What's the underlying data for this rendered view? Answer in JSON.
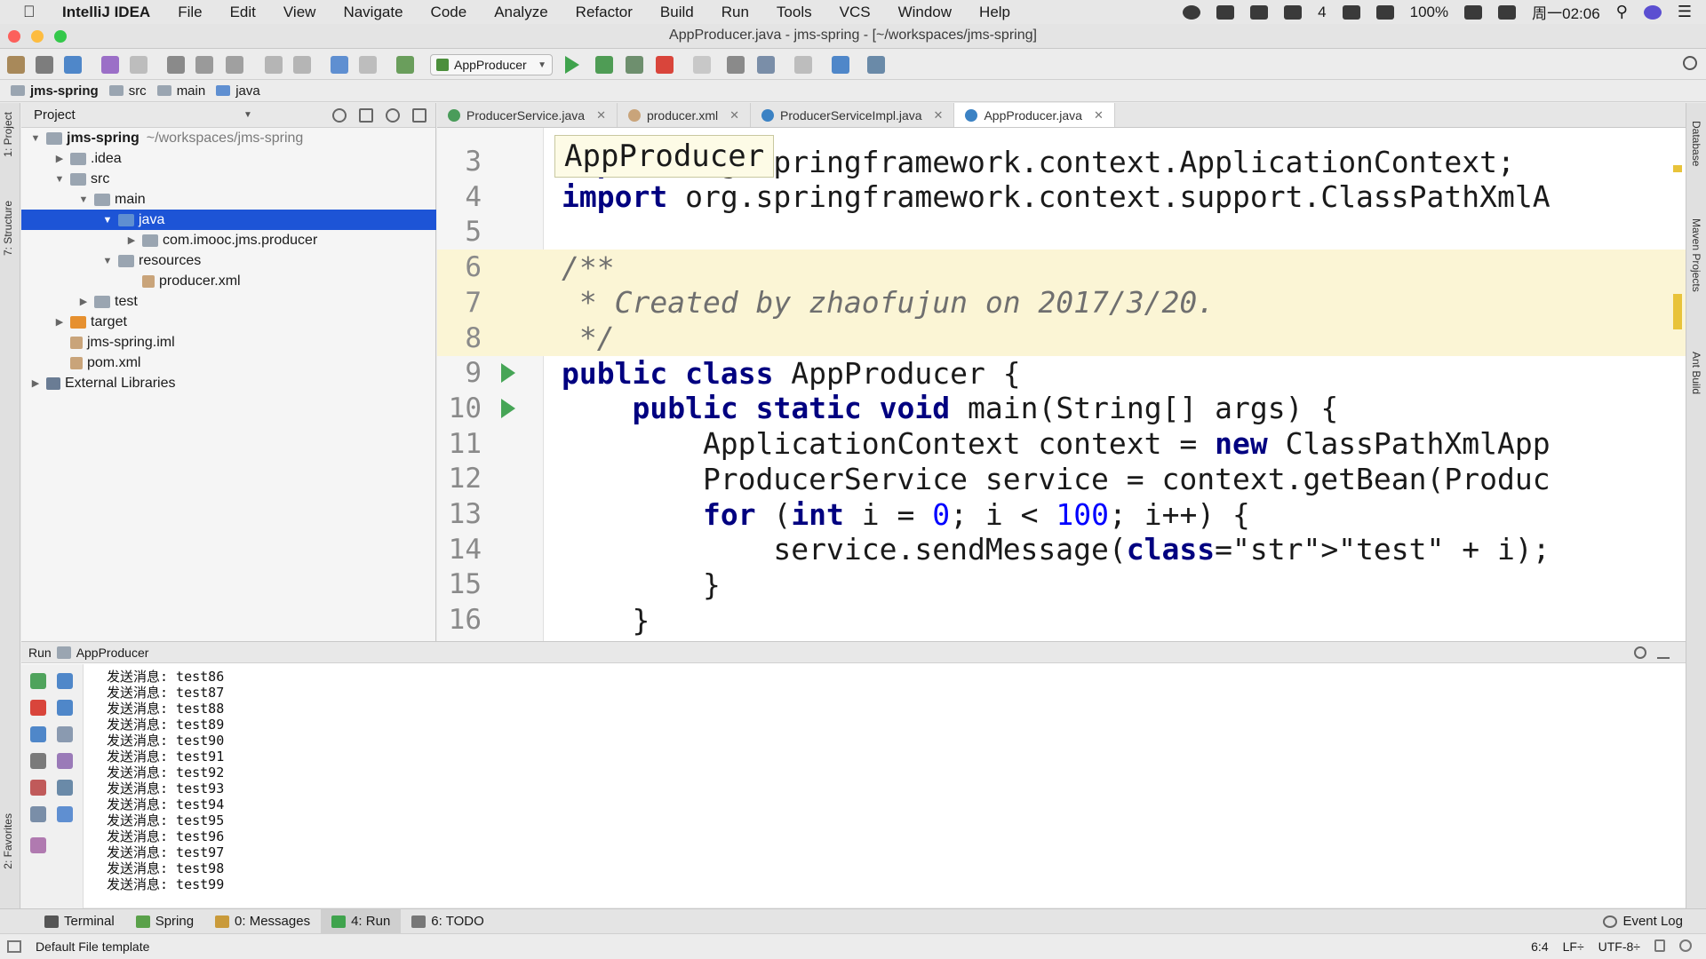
{
  "menubar": {
    "app_name": "IntelliJ IDEA",
    "items": [
      "File",
      "Edit",
      "View",
      "Navigate",
      "Code",
      "Analyze",
      "Refactor",
      "Build",
      "Run",
      "Tools",
      "VCS",
      "Window",
      "Help"
    ],
    "wechat_count": "4",
    "battery": "100%",
    "clock": "周一02:06"
  },
  "window": {
    "title": "AppProducer.java - jms-spring - [~/workspaces/jms-spring]"
  },
  "toolbar": {
    "run_config": "AppProducer"
  },
  "breadcrumb": [
    "jms-spring",
    "src",
    "main",
    "java"
  ],
  "project": {
    "header": "Project",
    "tree": [
      {
        "label": "jms-spring",
        "extra": "~/workspaces/jms-spring",
        "arrow": "▼",
        "icon": "folder",
        "bold": true
      },
      {
        "label": ".idea",
        "arrow": "▶",
        "icon": "folder"
      },
      {
        "label": "src",
        "arrow": "▼",
        "icon": "folder"
      },
      {
        "label": "main",
        "arrow": "▼",
        "icon": "folder"
      },
      {
        "label": "java",
        "arrow": "▼",
        "icon": "folder-blue",
        "selected": true
      },
      {
        "label": "com.imooc.jms.producer",
        "arrow": "▶",
        "icon": "folder"
      },
      {
        "label": "resources",
        "arrow": "▼",
        "icon": "folder"
      },
      {
        "label": "producer.xml",
        "arrow": "",
        "icon": "file"
      },
      {
        "label": "test",
        "arrow": "▶",
        "icon": "folder"
      },
      {
        "label": "target",
        "arrow": "▶",
        "icon": "folder-orange"
      },
      {
        "label": "jms-spring.iml",
        "arrow": "",
        "icon": "file"
      },
      {
        "label": "pom.xml",
        "arrow": "",
        "icon": "file"
      },
      {
        "label": "External Libraries",
        "arrow": "▶",
        "icon": "lib"
      }
    ]
  },
  "editor": {
    "tabs": [
      {
        "label": "ProducerService.java",
        "color": "#4a9c5a"
      },
      {
        "label": "producer.xml",
        "color": "#c9a47a"
      },
      {
        "label": "ProducerServiceImpl.java",
        "color": "#3b82c4"
      },
      {
        "label": "AppProducer.java",
        "color": "#3b82c4",
        "active": true
      }
    ],
    "popup": "AppProducer",
    "lines": [
      {
        "n": "3",
        "text": "import org.springframework.context.ApplicationContext;"
      },
      {
        "n": "4",
        "text": "import org.springframework.context.support.ClassPathXmlA"
      },
      {
        "n": "5",
        "text": ""
      },
      {
        "n": "6",
        "text": "/**"
      },
      {
        "n": "7",
        "text": " * Created by zhaofujun on 2017/3/20."
      },
      {
        "n": "8",
        "text": " */"
      },
      {
        "n": "9",
        "text": "public class AppProducer {"
      },
      {
        "n": "10",
        "text": "    public static void main(String[] args) {"
      },
      {
        "n": "11",
        "text": "        ApplicationContext context = new ClassPathXmlApp"
      },
      {
        "n": "12",
        "text": "        ProducerService service = context.getBean(Produc"
      },
      {
        "n": "13",
        "text": "        for (int i = 0; i < 100; i++) {"
      },
      {
        "n": "14",
        "text": "            service.sendMessage(\"test\" + i);"
      },
      {
        "n": "15",
        "text": "        }"
      },
      {
        "n": "16",
        "text": "    }"
      }
    ]
  },
  "run": {
    "label": "Run",
    "config": "AppProducer",
    "output": [
      "发送消息: test86",
      "发送消息: test87",
      "发送消息: test88",
      "发送消息: test89",
      "发送消息: test90",
      "发送消息: test91",
      "发送消息: test92",
      "发送消息: test93",
      "发送消息: test94",
      "发送消息: test95",
      "发送消息: test96",
      "发送消息: test97",
      "发送消息: test98",
      "发送消息: test99"
    ]
  },
  "side_tabs": {
    "left_project": "1: Project",
    "left_structure": "7: Structure",
    "left_favorites": "2: Favorites",
    "right_database": "Database",
    "right_maven": "Maven Projects",
    "right_ant": "Ant Build"
  },
  "bottom_tabs": [
    {
      "label": "Terminal"
    },
    {
      "label": "Spring"
    },
    {
      "label": "0: Messages"
    },
    {
      "label": "4: Run",
      "active": true
    },
    {
      "label": "6: TODO"
    }
  ],
  "event_log": "Event Log",
  "status": {
    "message": "Default File template",
    "position": "6:4",
    "line_sep": "LF÷",
    "encoding": "UTF-8÷"
  }
}
